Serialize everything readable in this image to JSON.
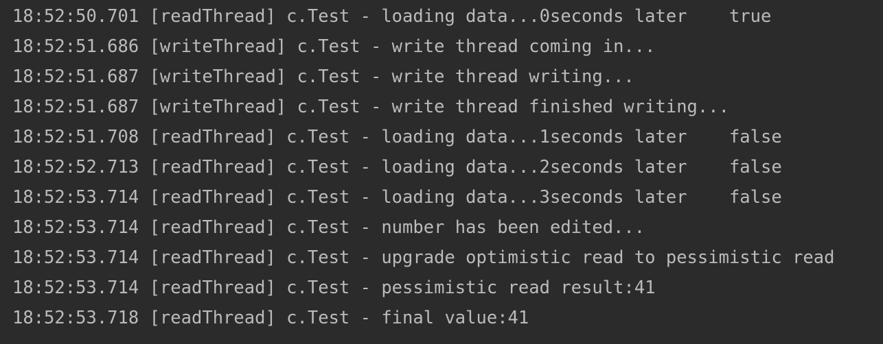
{
  "console": {
    "lines": [
      "18:52:50.701 [readThread] c.Test - loading data...0seconds later    true",
      "18:52:51.686 [writeThread] c.Test - write thread coming in...",
      "18:52:51.687 [writeThread] c.Test - write thread writing...",
      "18:52:51.687 [writeThread] c.Test - write thread finished writing...",
      "18:52:51.708 [readThread] c.Test - loading data...1seconds later    false",
      "18:52:52.713 [readThread] c.Test - loading data...2seconds later    false",
      "18:52:53.714 [readThread] c.Test - loading data...3seconds later    false",
      "18:52:53.714 [readThread] c.Test - number has been edited...",
      "18:52:53.714 [readThread] c.Test - upgrade optimistic read to pessimistic read",
      "18:52:53.714 [readThread] c.Test - pessimistic read result:41",
      "18:52:53.718 [readThread] c.Test - final value:41"
    ]
  },
  "colors": {
    "background": "#2b2b2b",
    "text": "#bbbbbb"
  }
}
